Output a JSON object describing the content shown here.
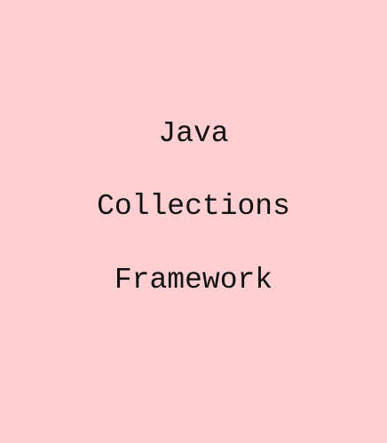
{
  "background_color": "#ffcfd2",
  "text_color": "#111111",
  "title_lines": [
    "Java",
    "Collections",
    "Framework"
  ]
}
